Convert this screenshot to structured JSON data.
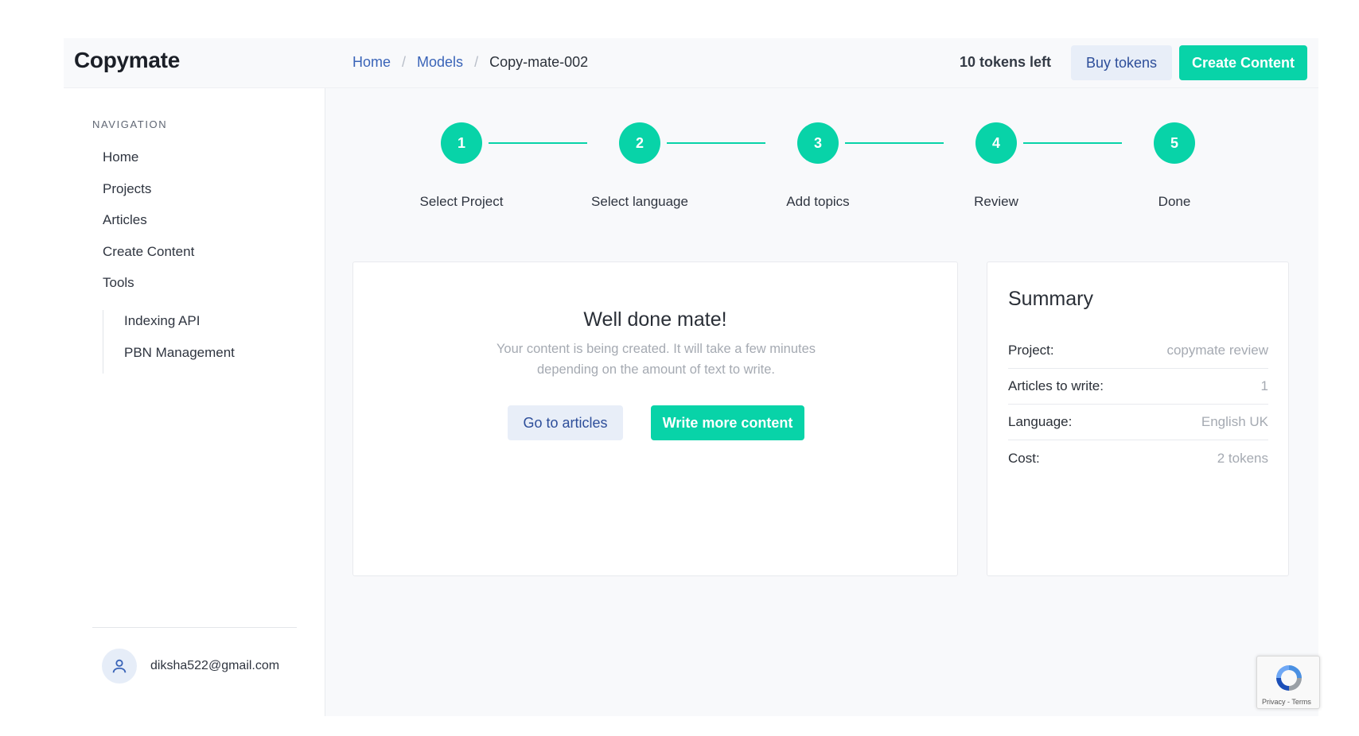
{
  "app": {
    "title": "Copymate"
  },
  "breadcrumb": {
    "home": "Home",
    "models": "Models",
    "current": "Copy-mate-002"
  },
  "header": {
    "tokens_left": "10 tokens left",
    "buy_tokens": "Buy tokens",
    "create_content": "Create Content"
  },
  "sidebar": {
    "heading": "NAVIGATION",
    "items": [
      "Home",
      "Projects",
      "Articles",
      "Create Content",
      "Tools"
    ],
    "tools_items": [
      "Indexing API",
      "PBN Management"
    ],
    "user_email": "diksha522@gmail.com"
  },
  "stepper": {
    "steps": [
      {
        "number": "1",
        "label": "Select Project"
      },
      {
        "number": "2",
        "label": "Select language"
      },
      {
        "number": "3",
        "label": "Add topics"
      },
      {
        "number": "4",
        "label": "Review"
      },
      {
        "number": "5",
        "label": "Done"
      }
    ]
  },
  "done_card": {
    "title": "Well done mate!",
    "text": "Your content is being created. It will take a few minutes depending on the amount of text to write.",
    "go_articles": "Go to articles",
    "write_more": "Write more content"
  },
  "summary": {
    "title": "Summary",
    "rows": [
      {
        "key": "Project:",
        "value": "copymate review"
      },
      {
        "key": "Articles to write:",
        "value": "1"
      },
      {
        "key": "Language:",
        "value": "English UK"
      },
      {
        "key": "Cost:",
        "value": "2 tokens"
      }
    ]
  },
  "recaptcha": {
    "links": "Privacy - Terms"
  },
  "colors": {
    "accent": "#08d3a8",
    "link": "#3a64b8",
    "light_button": "#e8eef8"
  }
}
